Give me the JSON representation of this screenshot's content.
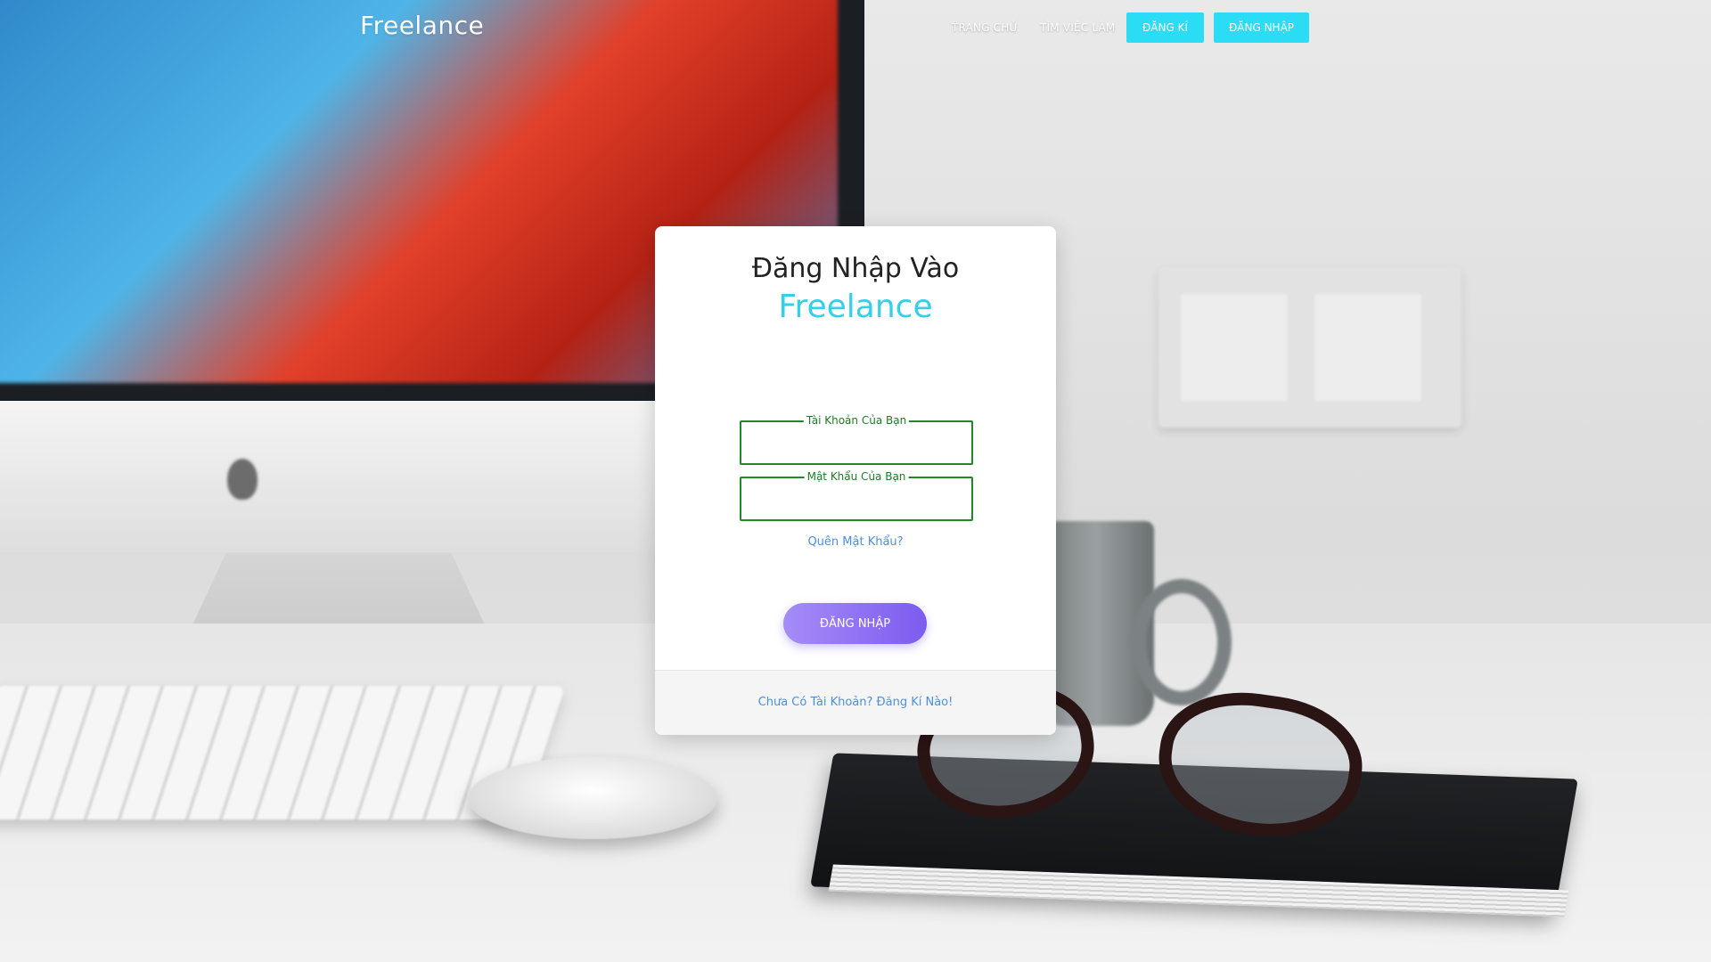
{
  "navbar": {
    "brand": "Freelance",
    "links": [
      "TRANG CHỦ",
      "TÌM VIỆC LÀM"
    ],
    "register_label": "ĐĂNG KÍ",
    "login_label": "ĐĂNG NHẬP"
  },
  "login_card": {
    "title": "Đăng Nhập Vào",
    "brand": "Freelance",
    "username_label": "Tài Khoản Của Bạn",
    "username_value": "",
    "password_label": "Mật Khẩu Của Bạn",
    "password_value": "",
    "forgot_password": "Quên Mật Khẩu?",
    "submit_label": "ĐĂNG NHẬP",
    "signup_prompt": "Chưa Có Tài Khoản? Đăng Kí Nào!"
  },
  "colors": {
    "accent_cyan": "#2bdcf5",
    "brand_cyan": "#35cfe8",
    "field_green": "#1f8a26",
    "link_blue": "#4a90e2",
    "button_purple": "#7b5cf0"
  }
}
